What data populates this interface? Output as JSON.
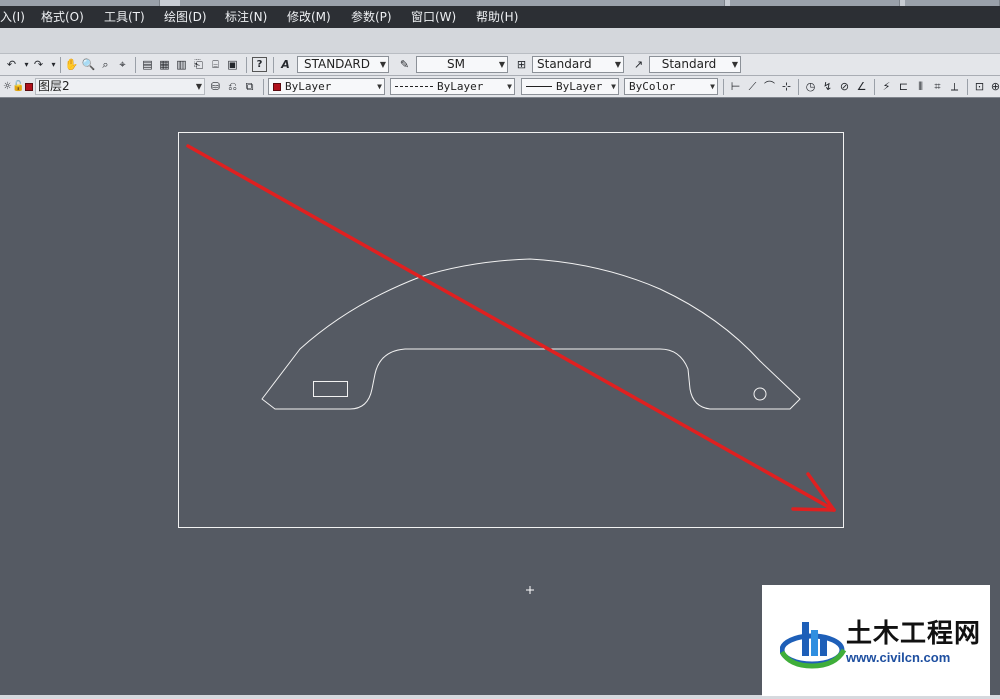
{
  "menubar": {
    "items": [
      "入(I)",
      "格式(O)",
      "工具(T)",
      "绘图(D)",
      "标注(N)",
      "修改(M)",
      "参数(P)",
      "窗口(W)",
      "帮助(H)"
    ]
  },
  "styles_toolbar": {
    "text_style": "STANDARD",
    "dim_style": "SM",
    "table_style": "Standard",
    "multileader_style": "Standard"
  },
  "layers_toolbar": {
    "current_layer": "图层2",
    "color": "ByLayer",
    "linetype": "ByLayer",
    "lineweight": "ByLayer",
    "plot_style": "ByColor",
    "layer_color": "#b0101c"
  },
  "annotation": {
    "arrow_color": "#e02020"
  },
  "watermark": {
    "site_name": "土木工程网",
    "url": "www.civilcn.com"
  }
}
